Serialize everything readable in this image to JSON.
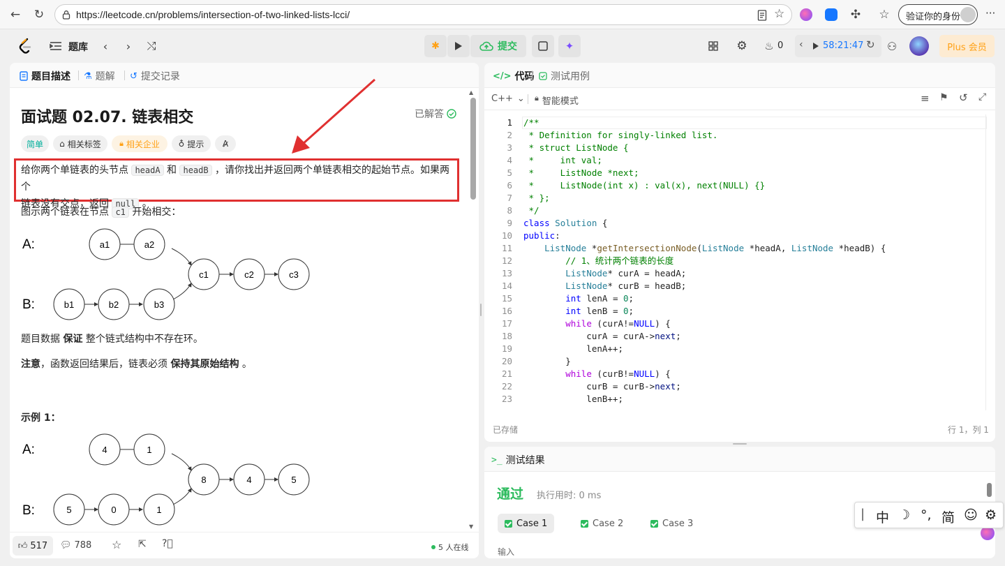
{
  "browser": {
    "url": "https://leetcode.cn/problems/intersection-of-two-linked-lists-lcci/",
    "verify_label": "验证你的身份",
    "more": "···"
  },
  "nav": {
    "problem_list": "题库",
    "submit_label": "提交",
    "streak_count": "0",
    "timer": "58:21:47",
    "plus_label": "Plus 会员"
  },
  "left": {
    "tabs": [
      "题目描述",
      "题解",
      "提交记录"
    ],
    "title": "面试题 02.07. 链表相交",
    "solved_label": "已解答",
    "tags": {
      "difficulty": "简单",
      "related_tags": "相关标签",
      "companies": "相关企业",
      "hint": "提示"
    },
    "desc_part1": "给你两个单链表的头节点 ",
    "headA": "headA",
    "desc_and": " 和 ",
    "headB": "headB",
    "desc_part2": " ，请你找出并返回两个单链表相交的起始节点。如果两个",
    "desc_line2": "链表没有交点，返回 ",
    "null_code": "null",
    "desc_end": " 。",
    "figure_intro_a": "图示两个链表在节点 ",
    "c1_code": "c1",
    "figure_intro_b": " 开始相交：",
    "diagram1": {
      "labelA": "A:",
      "labelB": "B:",
      "a_nodes": [
        "a1",
        "a2"
      ],
      "b_nodes": [
        "b1",
        "b2",
        "b3"
      ],
      "common": [
        "c1",
        "c2",
        "c3"
      ]
    },
    "guarantee_a": "题目数据 ",
    "guarantee_b": "保证",
    "guarantee_c": " 整个链式结构中不存在环。",
    "note_a": "注意",
    "note_b": "，函数返回结果后，链表必须 ",
    "note_c": "保持其原始结构",
    "note_d": " 。",
    "example_title": "示例 1：",
    "diagram2": {
      "labelA": "A:",
      "labelB": "B:",
      "a_nodes": [
        "4",
        "1"
      ],
      "b_nodes": [
        "5",
        "0",
        "1"
      ],
      "common": [
        "8",
        "4",
        "5"
      ]
    },
    "footer": {
      "likes": "517",
      "comments": "788",
      "online": "5 人在线"
    }
  },
  "code": {
    "tabs": [
      "代码",
      "测试用例"
    ],
    "language": "C++",
    "mode": "智能模式",
    "lines": [
      {
        "n": "1",
        "t": "/**"
      },
      {
        "n": "2",
        "t": " * Definition for singly-linked list."
      },
      {
        "n": "3",
        "t": " * struct ListNode {"
      },
      {
        "n": "4",
        "t": " *     int val;"
      },
      {
        "n": "5",
        "t": " *     ListNode *next;"
      },
      {
        "n": "6",
        "t": " *     ListNode(int x) : val(x), next(NULL) {}"
      },
      {
        "n": "7",
        "t": " * };"
      },
      {
        "n": "8",
        "t": " */"
      },
      {
        "n": "9",
        "t": "class Solution {"
      },
      {
        "n": "10",
        "t": "public:"
      },
      {
        "n": "11",
        "t": "    ListNode *getIntersectionNode(ListNode *headA, ListNode *headB) {"
      },
      {
        "n": "12",
        "t": "        // 1、统计两个链表的长度"
      },
      {
        "n": "13",
        "t": "        ListNode* curA = headA;"
      },
      {
        "n": "14",
        "t": "        ListNode* curB = headB;"
      },
      {
        "n": "15",
        "t": "        int lenA = 0;"
      },
      {
        "n": "16",
        "t": "        int lenB = 0;"
      },
      {
        "n": "17",
        "t": "        while (curA!=NULL) {"
      },
      {
        "n": "18",
        "t": "            curA = curA->next;"
      },
      {
        "n": "19",
        "t": "            lenA++;"
      },
      {
        "n": "20",
        "t": "        }"
      },
      {
        "n": "21",
        "t": "        while (curB!=NULL) {"
      },
      {
        "n": "22",
        "t": "            curB = curB->next;"
      },
      {
        "n": "23",
        "t": "            lenB++;"
      }
    ],
    "saved_label": "已存储",
    "cursor_pos": "行 1，列 1"
  },
  "result": {
    "title": "测试结果",
    "status": "通过",
    "runtime": "执行用时: 0 ms",
    "cases": [
      "Case 1",
      "Case 2",
      "Case 3"
    ],
    "input_label": "输入"
  },
  "ime": {
    "chinese": "中",
    "simplified": "简"
  },
  "colors": {
    "accent_green": "#2cbb5d",
    "easy_teal": "#00af9b",
    "annotation_red": "#e03030",
    "plus_orange": "#ffa116"
  }
}
